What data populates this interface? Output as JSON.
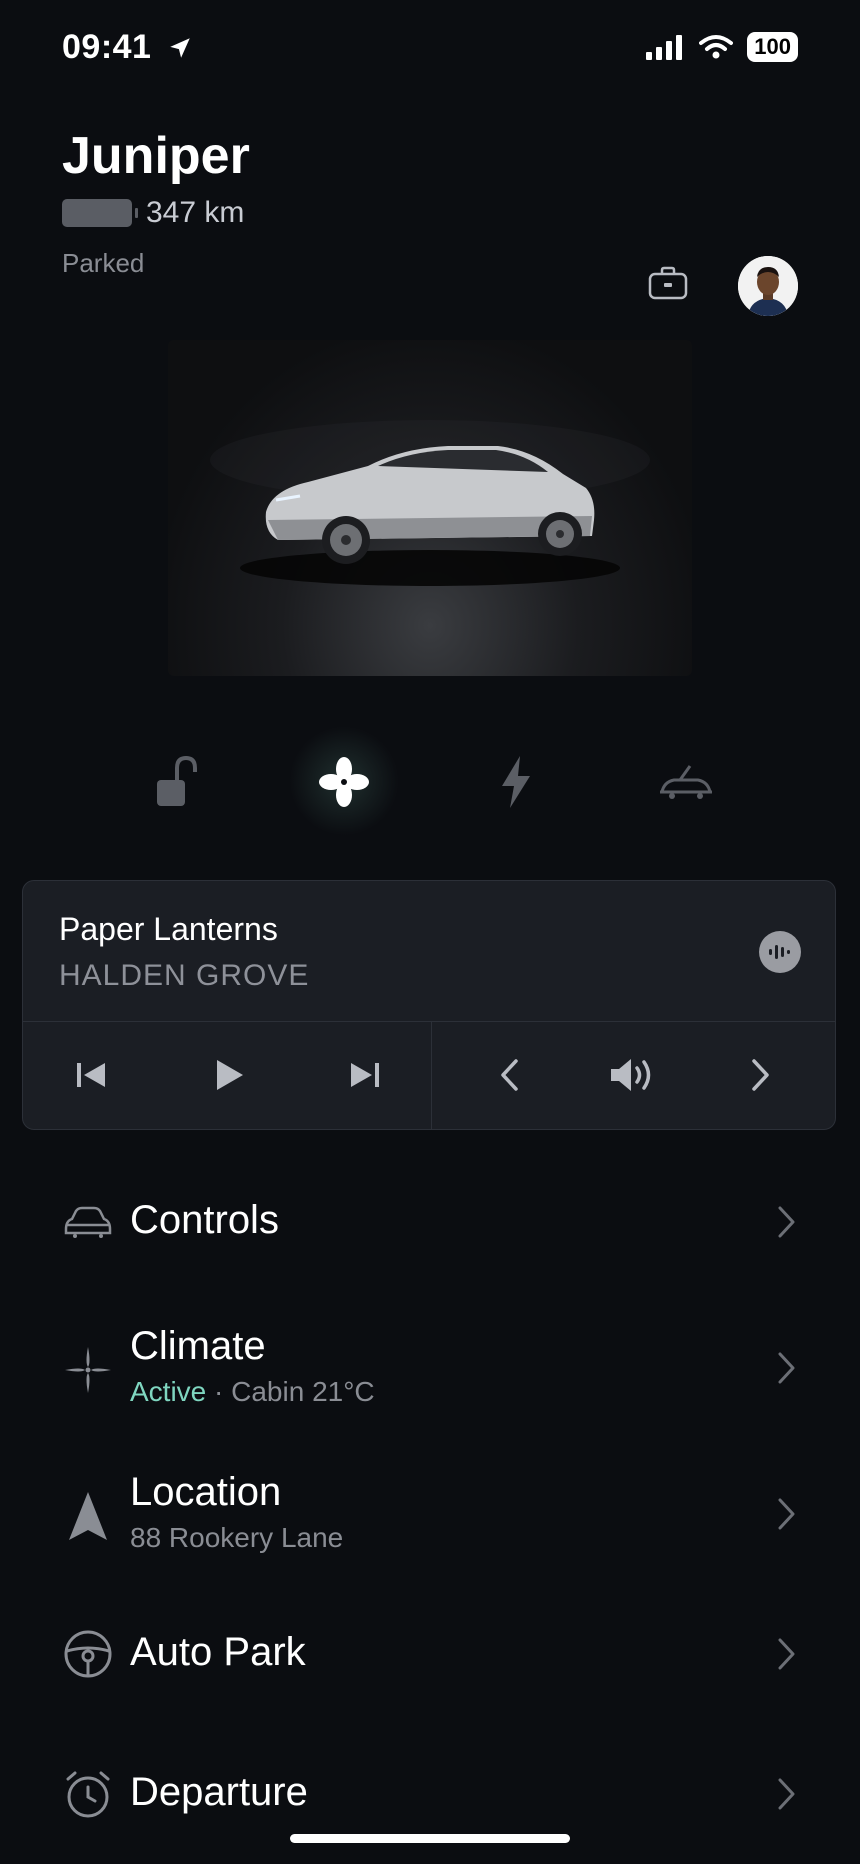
{
  "status_bar": {
    "time": "09:41",
    "battery": "100"
  },
  "vehicle": {
    "name": "Juniper",
    "range": "347 km",
    "status": "Parked"
  },
  "quick_actions": [
    {
      "name": "unlock",
      "icon": "unlock-icon",
      "active": false
    },
    {
      "name": "climate",
      "icon": "fan-icon",
      "active": true
    },
    {
      "name": "charge",
      "icon": "bolt-icon",
      "active": false
    },
    {
      "name": "trunk",
      "icon": "frunk-icon",
      "active": false
    }
  ],
  "media": {
    "title": "Paper Lanterns",
    "artist": "HALDEN GROVE"
  },
  "menu": {
    "controls": {
      "title": "Controls"
    },
    "climate": {
      "title": "Climate",
      "status": "Active",
      "detail": "· Cabin 21°C"
    },
    "location": {
      "title": "Location",
      "address": "88 Rookery Lane"
    },
    "autopark": {
      "title": "Auto Park"
    },
    "departure": {
      "title": "Departure"
    }
  },
  "colors": {
    "background": "#0b0d11",
    "accent": "#7fd6c0",
    "card": "#1b1e24"
  }
}
